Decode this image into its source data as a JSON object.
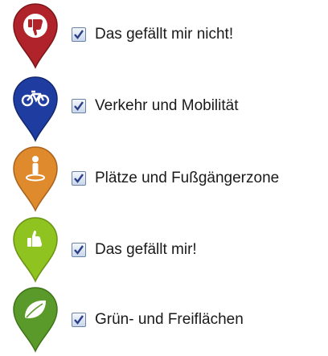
{
  "legend": {
    "items": [
      {
        "label": "Das gefällt mir nicht!",
        "checked": true,
        "icon": "thumbs-down-icon",
        "color": "#b0232a"
      },
      {
        "label": "Verkehr und Mobilität",
        "checked": true,
        "icon": "bicycle-icon",
        "color": "#1f3da0"
      },
      {
        "label": "Plätze und Fußgängerzone",
        "checked": true,
        "icon": "pedestrian-icon",
        "color": "#e08a2e"
      },
      {
        "label": "Das gefällt mir!",
        "checked": true,
        "icon": "thumbs-up-icon",
        "color": "#8fc31f"
      },
      {
        "label": "Grün- und Freiflächen",
        "checked": true,
        "icon": "leaf-icon",
        "color": "#5a9a2a"
      }
    ]
  }
}
